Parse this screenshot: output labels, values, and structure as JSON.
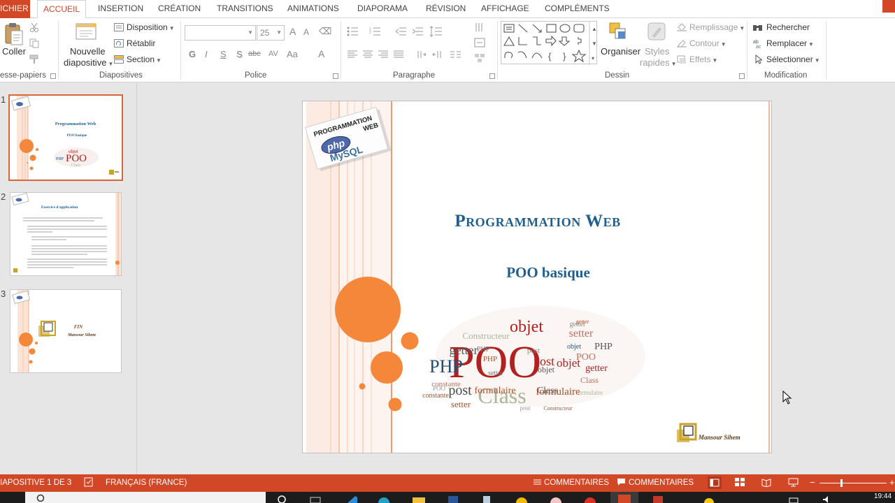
{
  "tabs": [
    {
      "label": "ICHIER"
    },
    {
      "label": "ACCUEIL"
    },
    {
      "label": "INSERTION"
    },
    {
      "label": "CRÉATION"
    },
    {
      "label": "TRANSITIONS"
    },
    {
      "label": "ANIMATIONS"
    },
    {
      "label": "DIAPORAMA"
    },
    {
      "label": "RÉVISION"
    },
    {
      "label": "AFFICHAGE"
    },
    {
      "label": "COMPLÉMENTS"
    }
  ],
  "ribbon": {
    "clipboard": {
      "paste": "Coller",
      "group": "esse-papiers"
    },
    "slides": {
      "new_slide_1": "Nouvelle",
      "new_slide_2": "diapositive",
      "layout": "Disposition",
      "reset": "Rétablir",
      "section": "Section",
      "group": "Diapositives"
    },
    "font": {
      "size": "25",
      "bold": "G",
      "italic": "I",
      "underline": "S",
      "shadow": "S",
      "strike": "abc",
      "spacing": "AV",
      "case": "Aa",
      "color": "A",
      "grow": "A",
      "shrink": "A",
      "group": "Police"
    },
    "paragraph": {
      "group": "Paragraphe"
    },
    "drawing": {
      "arrange": "Organiser",
      "styles_1": "Styles",
      "styles_2": "rapides",
      "fill": "Remplissage",
      "outline": "Contour",
      "effects": "Effets",
      "group": "Dessin"
    },
    "editing": {
      "find": "Rechercher",
      "replace": "Remplacer",
      "select": "Sélectionner",
      "group": "Modification"
    }
  },
  "thumbnails": [
    {
      "number": "1",
      "title": "Programmation Web",
      "subtitle": "POO basique"
    },
    {
      "number": "2",
      "title": "Exercice d'application"
    },
    {
      "number": "3",
      "line1": "FIN",
      "line2": "Mansour Sihem"
    }
  ],
  "slide": {
    "badge_line1": "PROGRAMMATION",
    "badge_line2": "WEB",
    "badge_php": "php",
    "badge_mysql": "MySQL",
    "title": "Programmation Web",
    "subtitle": "POO basique",
    "author": "Mansour Sihem",
    "cloud_words": [
      {
        "t": "POO",
        "c": "#b22020"
      },
      {
        "t": "objet",
        "c": "#b22020"
      },
      {
        "t": "PHP",
        "c": "#1f4e79"
      },
      {
        "t": "post",
        "c": "#4a4a4a"
      },
      {
        "t": "Class",
        "c": "#a8b898"
      },
      {
        "t": "getter",
        "c": "#555555"
      },
      {
        "t": "setter",
        "c": "#a0522d"
      },
      {
        "t": "formulaire",
        "c": "#b05030"
      },
      {
        "t": "constante",
        "c": "#c07060"
      },
      {
        "t": "Constructeur",
        "c": "#a8b898"
      },
      {
        "t": "post",
        "c": "#b22020"
      },
      {
        "t": "objet",
        "c": "#b22020"
      },
      {
        "t": "Class",
        "c": "#5a5a5a"
      },
      {
        "t": "getter",
        "c": "#b22020"
      },
      {
        "t": "PHP",
        "c": "#555555"
      },
      {
        "t": "formulaire",
        "c": "#a0522d"
      },
      {
        "t": "setter",
        "c": "#c07060"
      },
      {
        "t": "objet",
        "c": "#555555"
      },
      {
        "t": "PHP",
        "c": "#a0522d"
      },
      {
        "t": "getter",
        "c": "#888888"
      },
      {
        "t": "setter",
        "c": "#777777"
      },
      {
        "t": "post",
        "c": "#888888"
      },
      {
        "t": "POO",
        "c": "#c07060"
      },
      {
        "t": "Class",
        "c": "#c07060"
      },
      {
        "t": "constante",
        "c": "#a0522d"
      },
      {
        "t": "PHP",
        "c": "#777777"
      },
      {
        "t": "POO",
        "c": "#999999"
      },
      {
        "t": "objet",
        "c": "#1f4e79"
      },
      {
        "t": "formulaire",
        "c": "#a8b898"
      },
      {
        "t": "getter",
        "c": "#a0522d"
      },
      {
        "t": "Constructeur",
        "c": "#a0522d"
      },
      {
        "t": "post",
        "c": "#999999"
      }
    ]
  },
  "status": {
    "slide_info": "IAPOSITIVE 1 DE 3",
    "language": "FRANÇAIS (FRANCE)",
    "notes": "COMMENTAIRES",
    "comments": "COMMENTAIRES"
  },
  "taskbar": {
    "clock": "19:44"
  },
  "colors": {
    "accent": "#d24726",
    "slide_title": "#1f5f8f",
    "circle_orange": "#f5873a"
  }
}
